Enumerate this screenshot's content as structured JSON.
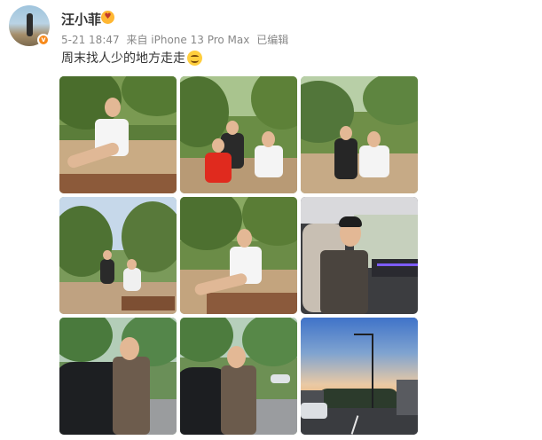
{
  "user": {
    "name": "汪小菲",
    "verified_symbol": "v",
    "badge_symbol": "♥"
  },
  "post": {
    "time": "5-21 18:47",
    "source": "来自 iPhone 13 Pro Max",
    "edited": "已编辑",
    "text": "周末找人少的地方走走",
    "emoji": "smile-emoji"
  },
  "photos": [
    {
      "name": "photo-1"
    },
    {
      "name": "photo-2"
    },
    {
      "name": "photo-3"
    },
    {
      "name": "photo-4"
    },
    {
      "name": "photo-5"
    },
    {
      "name": "photo-6"
    },
    {
      "name": "photo-7"
    },
    {
      "name": "photo-8"
    },
    {
      "name": "photo-9"
    }
  ],
  "colors": {
    "name": "#333333",
    "meta": "#888888",
    "verified": "#f78a1c"
  }
}
